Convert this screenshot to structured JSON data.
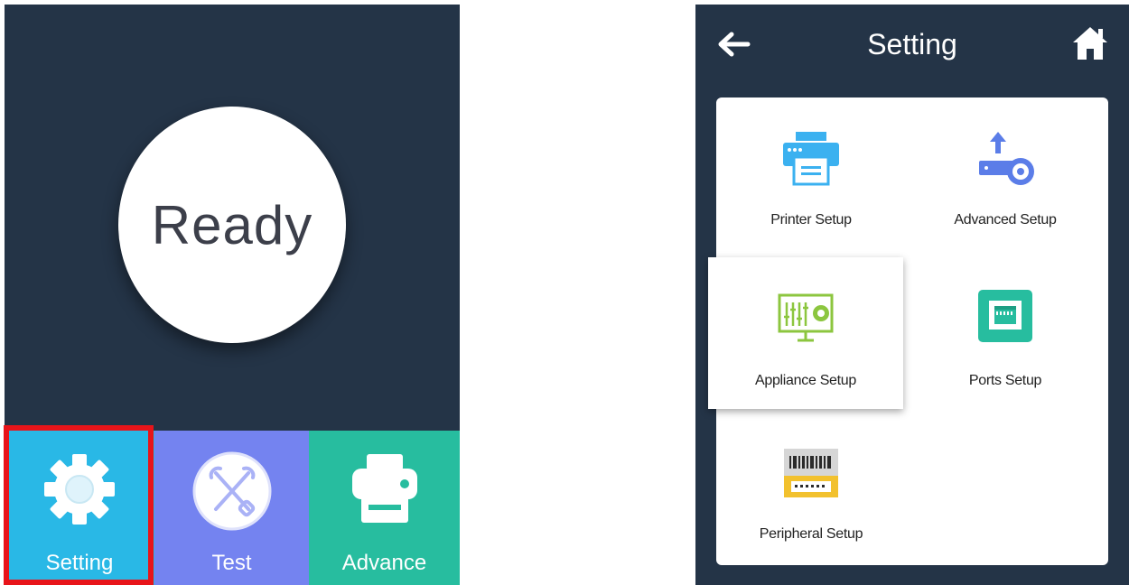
{
  "left_screen": {
    "status_text": "Ready",
    "tabs": [
      {
        "label": "Setting",
        "icon": "gear-icon",
        "color": "#29b8e6",
        "selected": true
      },
      {
        "label": "Test",
        "icon": "tools-icon",
        "color": "#7483f0"
      },
      {
        "label": "Advance",
        "icon": "printer-icon",
        "color": "#27bd9f"
      }
    ]
  },
  "right_screen": {
    "header": {
      "title": "Setting",
      "back_icon": "arrow-left-icon",
      "home_icon": "home-icon"
    },
    "menu": [
      {
        "label": "Printer Setup",
        "icon": "printer-setup-icon"
      },
      {
        "label": "Advanced Setup",
        "icon": "advanced-setup-icon"
      },
      {
        "label": "Appliance Setup",
        "icon": "appliance-setup-icon",
        "selected": true
      },
      {
        "label": "Ports Setup",
        "icon": "ports-setup-icon"
      },
      {
        "label": "Peripheral Setup",
        "icon": "peripheral-setup-icon"
      }
    ]
  },
  "colors": {
    "screen_bg": "#243447",
    "highlight_border": "#e8141a"
  }
}
